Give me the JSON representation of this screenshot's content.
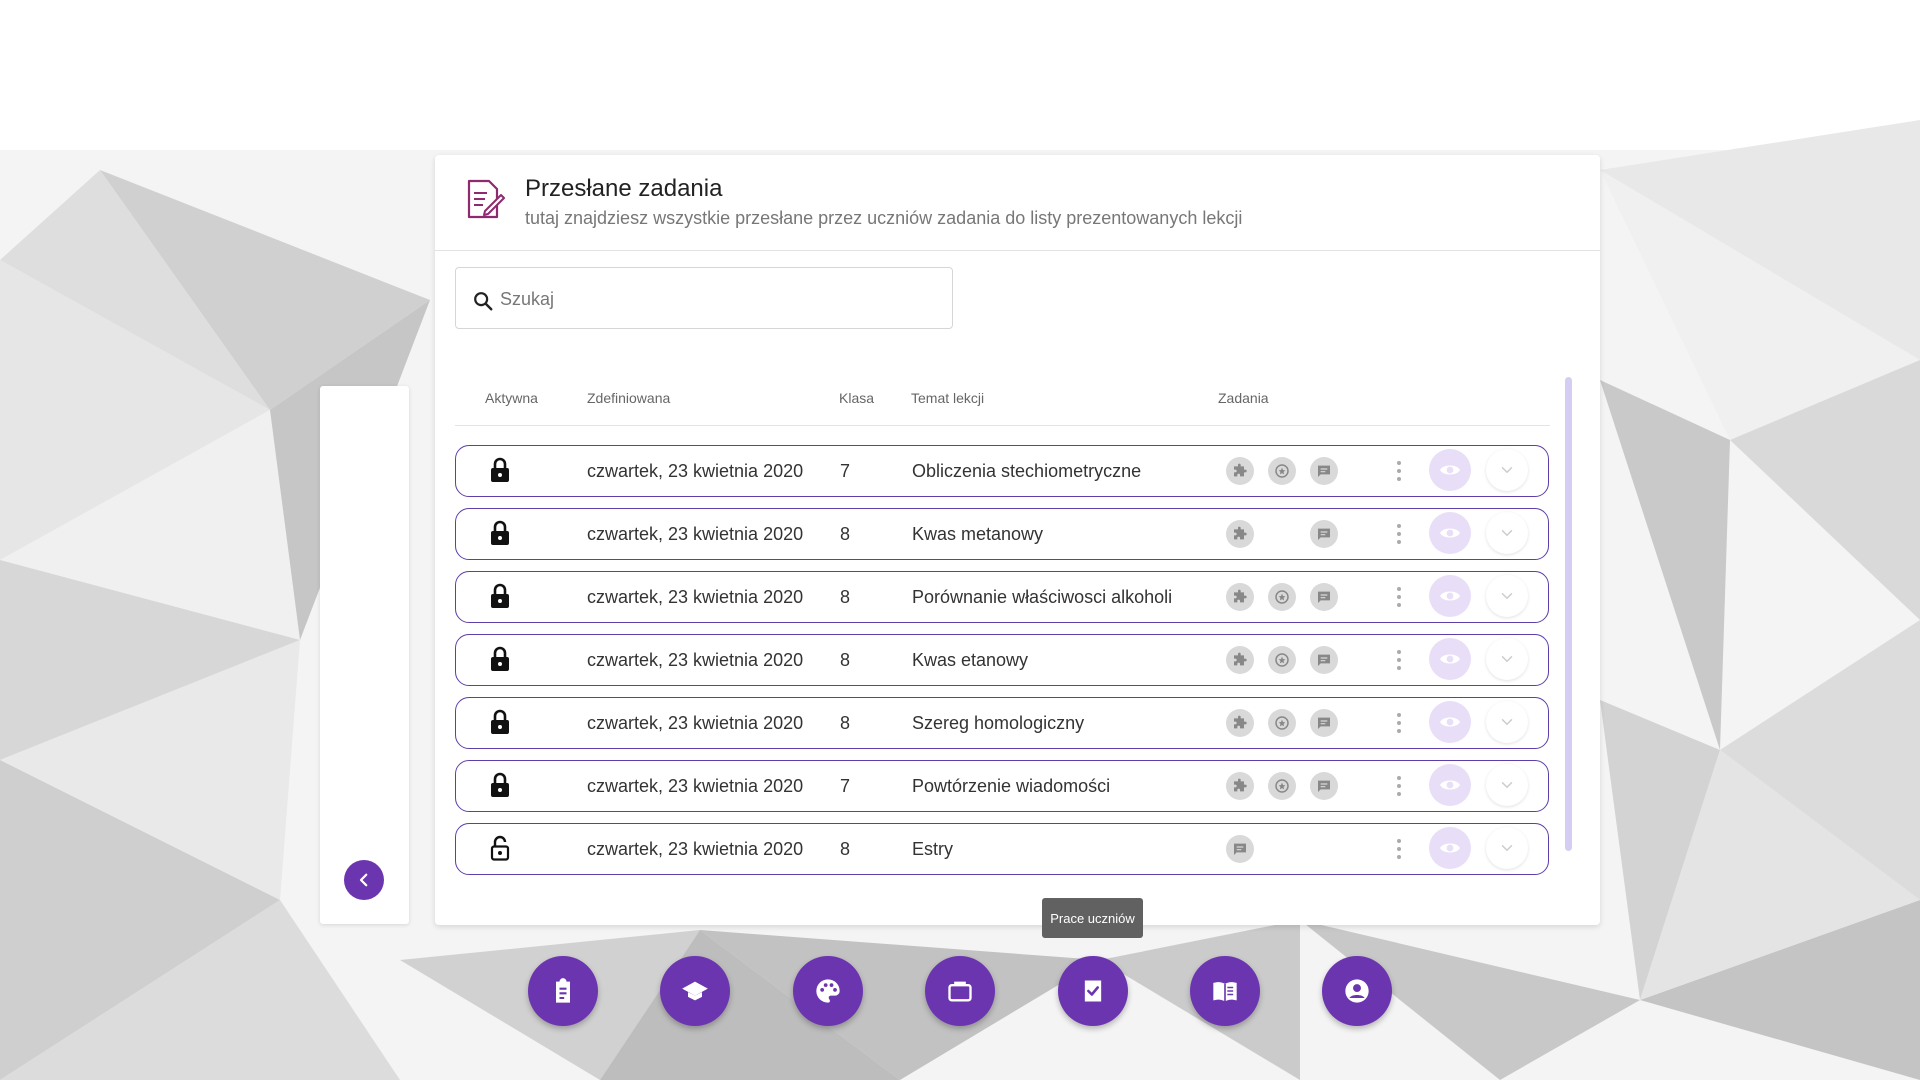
{
  "header": {
    "title": "Przesłane zadania",
    "subtitle": "tutaj znajdziesz wszystkie przesłane przez uczniów zadania do listy prezentowanych lekcji"
  },
  "search": {
    "placeholder": "Szukaj",
    "value": ""
  },
  "table": {
    "columns": [
      "Aktywna",
      "Zdefiniowana",
      "Klasa",
      "Temat lekcji",
      "Zadania"
    ],
    "rows": [
      {
        "locked": true,
        "date": "czwartek, 23 kwietnia 2020",
        "class": "7",
        "topic": "Obliczenia stechiometryczne",
        "tasks": [
          "puzzle-icon",
          "star-icon",
          "message-icon"
        ]
      },
      {
        "locked": true,
        "date": "czwartek, 23 kwietnia 2020",
        "class": "8",
        "topic": "Kwas metanowy",
        "tasks": [
          "puzzle-icon",
          "message-icon"
        ]
      },
      {
        "locked": true,
        "date": "czwartek, 23 kwietnia 2020",
        "class": "8",
        "topic": "Porównanie właściwosci alkoholi",
        "tasks": [
          "puzzle-icon",
          "star-icon",
          "message-icon"
        ]
      },
      {
        "locked": true,
        "date": "czwartek, 23 kwietnia 2020",
        "class": "8",
        "topic": "Kwas etanowy",
        "tasks": [
          "puzzle-icon",
          "star-icon",
          "message-icon"
        ]
      },
      {
        "locked": true,
        "date": "czwartek, 23 kwietnia 2020",
        "class": "8",
        "topic": "Szereg homologiczny",
        "tasks": [
          "puzzle-icon",
          "star-icon",
          "message-icon"
        ]
      },
      {
        "locked": true,
        "date": "czwartek, 23 kwietnia 2020",
        "class": "7",
        "topic": "Powtórzenie wiadomości",
        "tasks": [
          "puzzle-icon",
          "star-icon",
          "message-icon"
        ]
      },
      {
        "locked": false,
        "date": "czwartek, 23 kwietnia 2020",
        "class": "8",
        "topic": "Estry",
        "tasks": [
          "message-icon"
        ]
      }
    ]
  },
  "tooltip": "Prace uczniów",
  "bottom_nav": [
    "clipboard-icon",
    "graduation-cap-icon",
    "palette-icon",
    "briefcase-icon",
    "assignment-check-icon",
    "book-icon",
    "account-icon"
  ],
  "colors": {
    "accent": "#6c35b0",
    "row_border": "#5e3ea8",
    "eye_bg": "#e8def8",
    "header_icon": "#8e2a6f"
  }
}
